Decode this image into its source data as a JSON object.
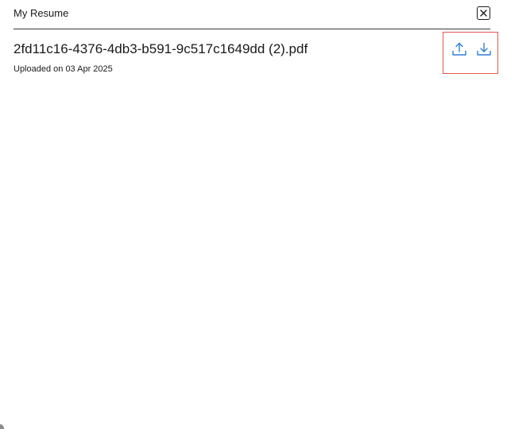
{
  "modal": {
    "title": "My Resume"
  },
  "file": {
    "name": "2fd11c16-4376-4db3-b591-9c517c1649dd (2).pdf",
    "uploaded_text": "Uploaded on 03 Apr 2025"
  },
  "icons": {
    "close": "close-icon",
    "upload": "upload-icon",
    "download": "download-icon"
  },
  "colors": {
    "accent": "#2f7fd6",
    "highlight_border": "#e8574a",
    "text": "#1a1a1a"
  }
}
